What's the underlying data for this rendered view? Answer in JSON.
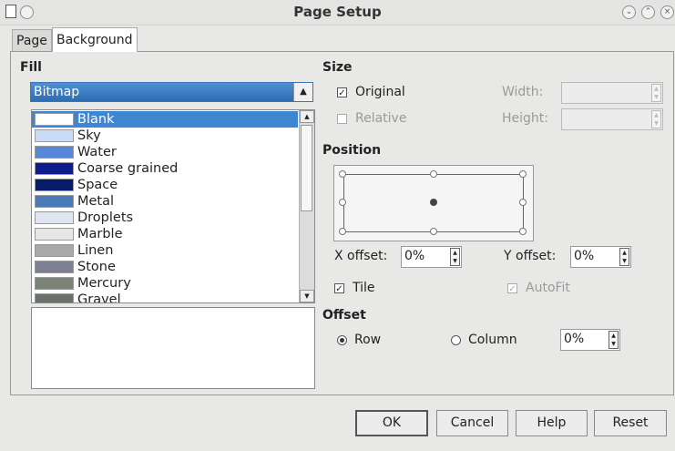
{
  "window": {
    "title": "Page Setup"
  },
  "tabs": [
    {
      "label": "Page"
    },
    {
      "label": "Background"
    }
  ],
  "fill": {
    "heading": "Fill",
    "selected": "Bitmap",
    "bitmaps": [
      {
        "label": "Blank",
        "color": "#ffffff"
      },
      {
        "label": "Sky",
        "color": "#c8dcf4"
      },
      {
        "label": "Water",
        "color": "#5a86d8"
      },
      {
        "label": "Coarse grained",
        "color": "#0d1e8c"
      },
      {
        "label": "Space",
        "color": "#081a6a"
      },
      {
        "label": "Metal",
        "color": "#4a7ab8"
      },
      {
        "label": "Droplets",
        "color": "#dfe6f2"
      },
      {
        "label": "Marble",
        "color": "#e6e6e6"
      },
      {
        "label": "Linen",
        "color": "#a8a8a8"
      },
      {
        "label": "Stone",
        "color": "#7d7f93"
      },
      {
        "label": "Mercury",
        "color": "#7b8278"
      },
      {
        "label": "Gravel",
        "color": "#6a706a"
      }
    ]
  },
  "size": {
    "heading": "Size",
    "original": "Original",
    "relative": "Relative",
    "width_label": "Width:",
    "height_label": "Height:"
  },
  "position": {
    "heading": "Position"
  },
  "offsets": {
    "x_label": "X offset:",
    "x_value": "0%",
    "y_label": "Y offset:",
    "y_value": "0%",
    "tile": "Tile",
    "autofit": "AutoFit"
  },
  "offset": {
    "heading": "Offset",
    "row": "Row",
    "column": "Column",
    "value": "0%"
  },
  "buttons": {
    "ok": "OK",
    "cancel": "Cancel",
    "help": "Help",
    "reset": "Reset"
  },
  "colors": {
    "accent": "#3f86d2",
    "selected_text": "#ffffff"
  }
}
